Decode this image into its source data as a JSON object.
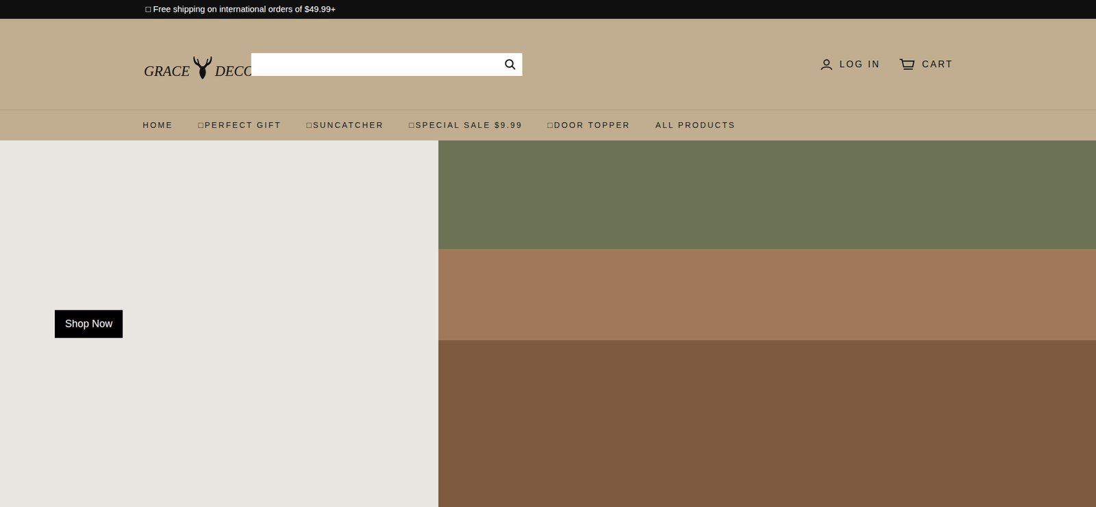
{
  "announcement": "□ Free shipping on international orders of $49.99+",
  "logo": {
    "left": "GRACE",
    "right": "DECOR"
  },
  "search": {
    "placeholder": "Search"
  },
  "account": {
    "login": "LOG IN",
    "cart": "CART"
  },
  "nav": [
    {
      "label": "HOME"
    },
    {
      "label": "□PERFECT GIFT"
    },
    {
      "label": "□SUNCATCHER"
    },
    {
      "label": "□SPECIAL SALE $9.99"
    },
    {
      "label": "□DOOR TOPPER"
    },
    {
      "label": "ALL PRODUCTS"
    }
  ],
  "hero": {
    "button": "Shop Now"
  }
}
